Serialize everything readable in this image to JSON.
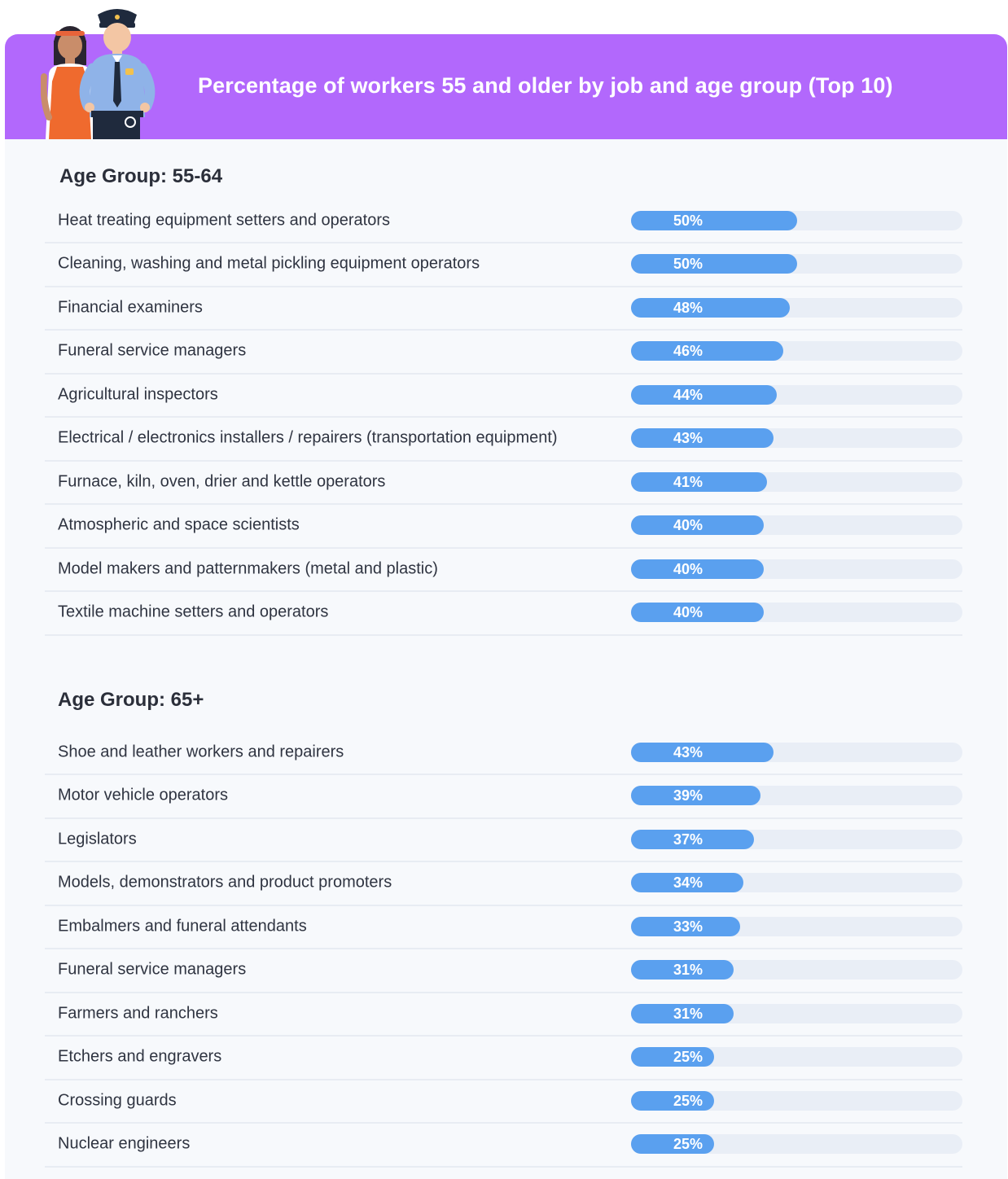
{
  "header": {
    "title": "Percentage of workers 55 and older by job and age group (Top 10)"
  },
  "colors": {
    "header_bg": "#b268fc",
    "panel_bg": "#f7f9fc",
    "bar": "#5aa0ef",
    "track": "#e9eef6"
  },
  "icons": [
    "worker-woman-apron-icon",
    "police-officer-icon"
  ],
  "chart_data": [
    {
      "type": "bar",
      "orientation": "horizontal",
      "title": "Age Group: 55-64",
      "xlim": [
        0,
        100
      ],
      "value_suffix": "%",
      "categories": [
        "Heat treating equipment setters and operators",
        "Cleaning, washing and metal pickling equipment operators",
        "Financial examiners",
        "Funeral service managers",
        "Agricultural inspectors",
        "Electrical / electronics installers / repairers (transportation equipment)",
        "Furnace, kiln, oven, drier and kettle operators",
        "Atmospheric and space scientists",
        "Model makers and patternmakers (metal and plastic)",
        "Textile machine setters and operators"
      ],
      "values": [
        50,
        50,
        48,
        46,
        44,
        43,
        41,
        40,
        40,
        40
      ],
      "labels": [
        "50%",
        "50%",
        "48%",
        "46%",
        "44%",
        "43%",
        "41%",
        "40%",
        "40%",
        "40%"
      ]
    },
    {
      "type": "bar",
      "orientation": "horizontal",
      "title": "Age Group: 65+",
      "xlim": [
        0,
        100
      ],
      "value_suffix": "%",
      "categories": [
        "Shoe and leather workers and repairers",
        "Motor vehicle operators",
        "Legislators",
        "Models, demonstrators and product promoters",
        "Embalmers and funeral attendants",
        "Funeral service managers",
        "Farmers and ranchers",
        "Etchers and engravers",
        "Crossing guards",
        "Nuclear engineers"
      ],
      "values": [
        43,
        39,
        37,
        34,
        33,
        31,
        31,
        25,
        25,
        25
      ],
      "labels": [
        "43%",
        "39%",
        "37%",
        "34%",
        "33%",
        "31%",
        "31%",
        "25%",
        "25%",
        "25%"
      ]
    }
  ]
}
